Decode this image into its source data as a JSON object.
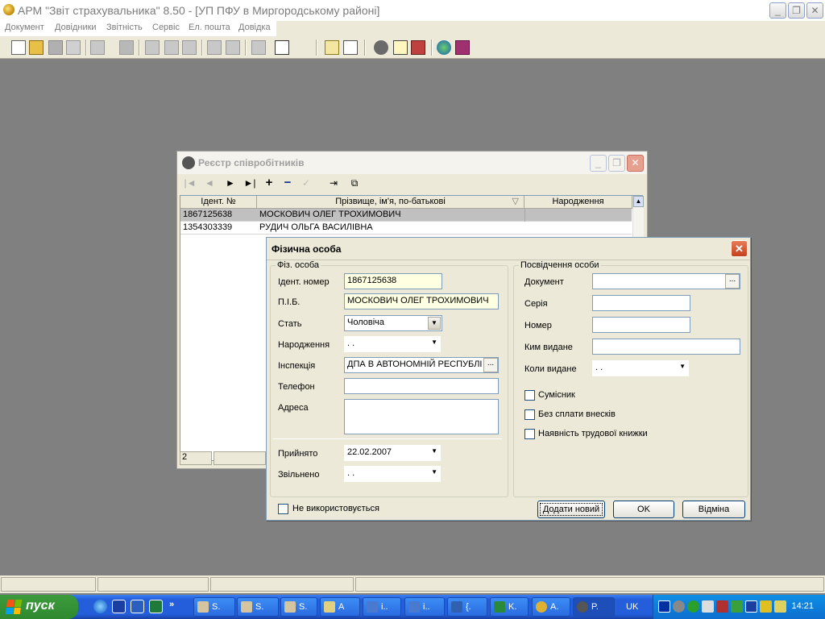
{
  "app": {
    "title": "АРМ \"Звіт страхувальника\" 8.50 - [УП ПФУ в Миргородському районі]",
    "window_buttons": {
      "minimize": "_",
      "restore": "❐",
      "close": "✕"
    }
  },
  "menu": [
    "Документ",
    "Довідники",
    "Звітність",
    "Сервіс",
    "Ел. пошта",
    "Довідка"
  ],
  "registry": {
    "title": "Реєстр співробітників",
    "nav": [
      "|◄",
      "◄",
      "►",
      "►|",
      "+",
      "−",
      "✓",
      "⇥",
      "⧉"
    ],
    "columns": [
      "Ідент. №",
      "Прізвище, ім'я, по-батькові",
      "Народження"
    ],
    "sort_indicator": "▽",
    "rows": [
      {
        "id": "1867125638",
        "name": "МОСКОВИЧ ОЛЕГ ТРОХИМОВИЧ",
        "birth": ""
      },
      {
        "id": "1354303339",
        "name": "РУДИЧ ОЛЬГА ВАСИЛІВНА",
        "birth": ""
      }
    ],
    "status_count": "2"
  },
  "dialog": {
    "title": "Фізична особа",
    "close": "✕",
    "person_group": "Фіз. особа",
    "labels": {
      "id": "Ідент. номер",
      "name": "П.І.Б.",
      "sex": "Стать",
      "birth": "Народження",
      "inspection": "Інспекція",
      "phone": "Телефон",
      "address": "Адреса",
      "hired": "Прийнято",
      "fired": "Звільнено"
    },
    "values": {
      "id": "1867125638",
      "name": "МОСКОВИЧ ОЛЕГ ТРОХИМОВИЧ",
      "sex": "Чоловіча",
      "birth": ". .",
      "inspection": "ДПА В АВТОНОМНІЙ РЕСПУБЛІ",
      "phone": "",
      "address": "",
      "hired": "22.02.2007",
      "fired": ". ."
    },
    "id_group": "Посвідчення особи",
    "id_labels": {
      "document": "Документ",
      "series": "Серія",
      "number": "Номер",
      "issued_by": "Ким видане",
      "issued_on": "Коли видане"
    },
    "id_values": {
      "document": "",
      "series": "",
      "number": "",
      "issued_by": "",
      "issued_on": ". ."
    },
    "checkboxes": [
      "Сумісник",
      "Без сплати внесків",
      "Наявність трудової книжки"
    ],
    "not_used": "Не використовується",
    "buttons": {
      "add": "Додати новий",
      "ok": "OK",
      "cancel": "Відміна"
    }
  },
  "taskbar": {
    "start": "пуск",
    "overflow": "»",
    "tasks": [
      "S.",
      "S.",
      "S.",
      "A",
      "i..",
      "i..",
      "{.",
      "K.",
      "A.",
      "P."
    ],
    "lang": "UK",
    "clock": "14:21"
  }
}
